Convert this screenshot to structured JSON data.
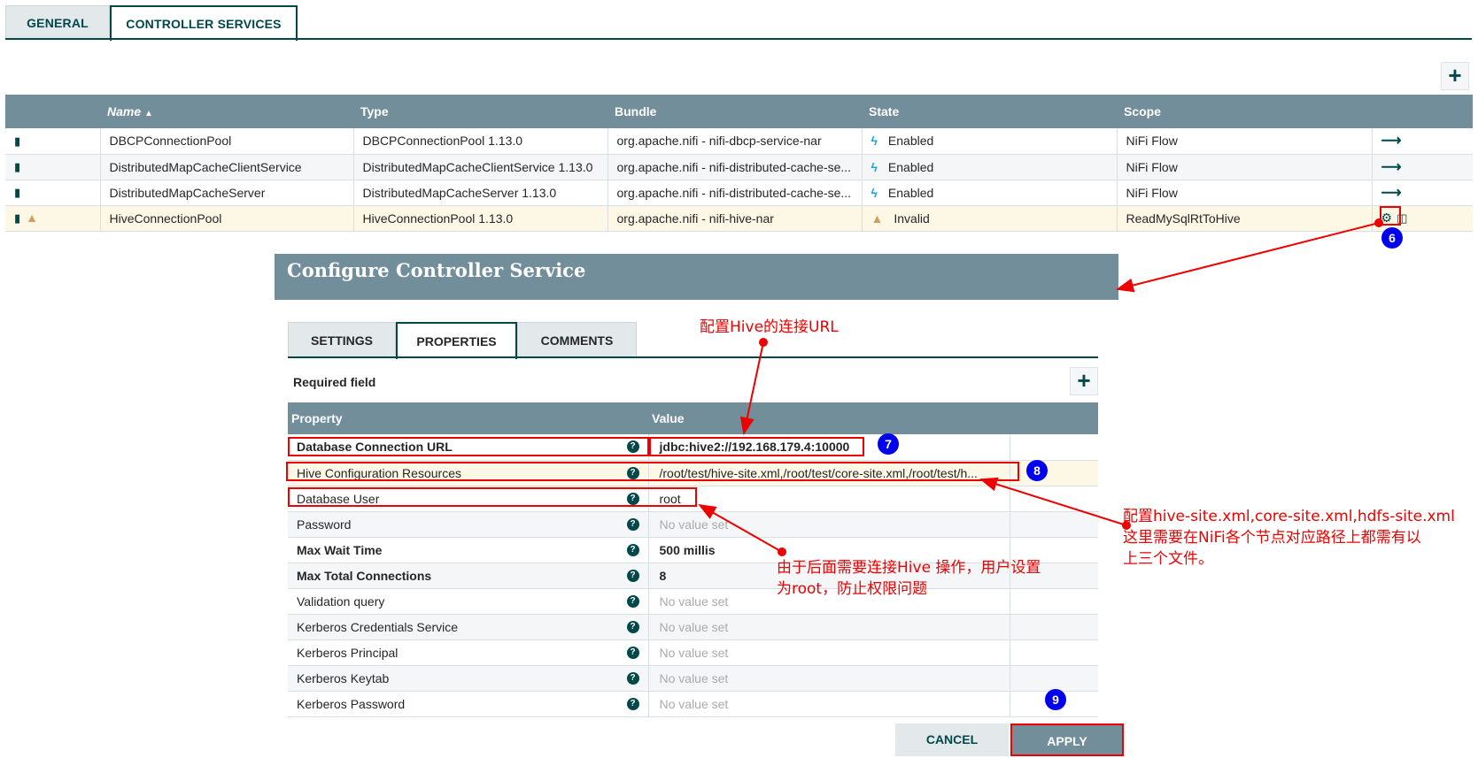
{
  "top_tabs": [
    {
      "label": "GENERAL",
      "active": false
    },
    {
      "label": "CONTROLLER SERVICES",
      "active": true
    }
  ],
  "services": {
    "columns": [
      "",
      "Name",
      "Type",
      "Bundle",
      "State",
      "Scope",
      ""
    ],
    "sort_indicator": "▲",
    "rows": [
      {
        "name": "DBCPConnectionPool",
        "type": "DBCPConnectionPool 1.13.0",
        "bundle": "org.apache.nifi - nifi-dbcp-service-nar",
        "state": "Enabled",
        "state_icon": "bolt-icon",
        "scope": "NiFi Flow",
        "warning": false
      },
      {
        "name": "DistributedMapCacheClientService",
        "type": "DistributedMapCacheClientService 1.13.0",
        "bundle": "org.apache.nifi - nifi-distributed-cache-se...",
        "state": "Enabled",
        "state_icon": "bolt-icon",
        "scope": "NiFi Flow",
        "warning": false
      },
      {
        "name": "DistributedMapCacheServer",
        "type": "DistributedMapCacheServer 1.13.0",
        "bundle": "org.apache.nifi - nifi-distributed-cache-se...",
        "state": "Enabled",
        "state_icon": "bolt-icon",
        "scope": "NiFi Flow",
        "warning": false
      },
      {
        "name": "HiveConnectionPool",
        "type": "HiveConnectionPool 1.13.0",
        "bundle": "org.apache.nifi - nifi-hive-nar",
        "state": "Invalid",
        "state_icon": "warning-icon",
        "scope": "ReadMySqlRtToHive",
        "warning": true
      }
    ]
  },
  "dialog": {
    "title": "Configure Controller Service",
    "tabs": [
      {
        "label": "SETTINGS",
        "active": false
      },
      {
        "label": "PROPERTIES",
        "active": true
      },
      {
        "label": "COMMENTS",
        "active": false
      }
    ],
    "required_label": "Required field",
    "columns": [
      "Property",
      "Value"
    ],
    "properties": [
      {
        "name": "Database Connection URL",
        "value": "jdbc:hive2://192.168.179.4:10000",
        "required": true,
        "set": true
      },
      {
        "name": "Hive Configuration Resources",
        "value": "/root/test/hive-site.xml,/root/test/core-site.xml,/root/test/h...",
        "required": false,
        "set": true
      },
      {
        "name": "Database User",
        "value": "root",
        "required": false,
        "set": true
      },
      {
        "name": "Password",
        "value": "No value set",
        "required": false,
        "set": false
      },
      {
        "name": "Max Wait Time",
        "value": "500 millis",
        "required": true,
        "set": true
      },
      {
        "name": "Max Total Connections",
        "value": "8",
        "required": true,
        "set": true
      },
      {
        "name": "Validation query",
        "value": "No value set",
        "required": false,
        "set": false
      },
      {
        "name": "Kerberos Credentials Service",
        "value": "No value set",
        "required": false,
        "set": false
      },
      {
        "name": "Kerberos Principal",
        "value": "No value set",
        "required": false,
        "set": false
      },
      {
        "name": "Kerberos Keytab",
        "value": "No value set",
        "required": false,
        "set": false
      },
      {
        "name": "Kerberos Password",
        "value": "No value set",
        "required": false,
        "set": false
      }
    ],
    "cancel_label": "CANCEL",
    "apply_label": "APPLY"
  },
  "annotations": {
    "badges": [
      "6",
      "7",
      "8",
      "9"
    ],
    "note_url": "配置Hive的连接URL",
    "note_files": [
      "配置hive-site.xml,core-site.xml,hdfs-site.xml",
      "这里需要在NiFi各个节点对应路径上都需有以",
      "上三个文件。"
    ],
    "note_user": [
      "由于后面需要连接Hive 操作，用户设置",
      "为root，防止权限问题"
    ],
    "color": "#ee0000",
    "badge_color": "#0000ee"
  },
  "icons": {
    "plus": "+",
    "help": "?",
    "book": "▮",
    "warning": "⚠",
    "bolt": "ϟ",
    "go": "⟶",
    "gear": "⚙",
    "trash": "🗑"
  }
}
